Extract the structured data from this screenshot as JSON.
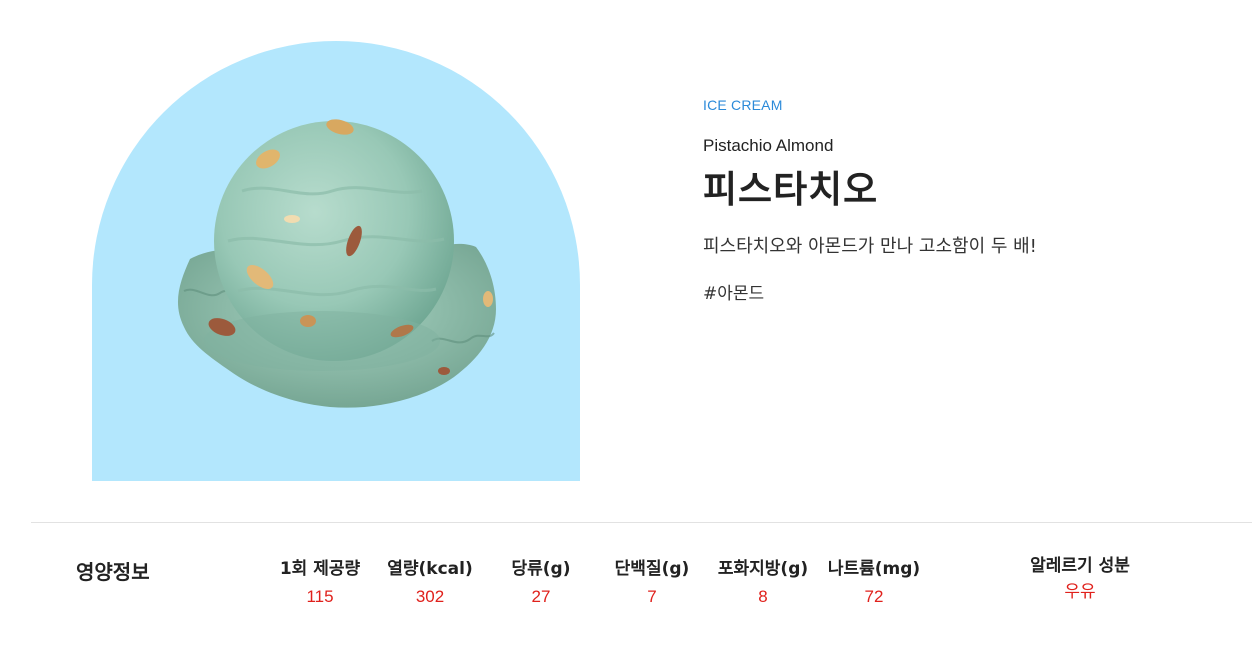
{
  "product": {
    "category": "ICE CREAM",
    "name_en": "Pistachio Almond",
    "name_ko": "피스타치오",
    "description": "피스타치오와 아몬드가 만나 고소함이 두 배!",
    "hashtag": "#아몬드",
    "image_bg_color": "#b3e7fd",
    "image_icon": "ice-cream-scoop"
  },
  "nutrition": {
    "title": "영양정보",
    "columns": [
      {
        "label": "1회 제공량",
        "value": "115"
      },
      {
        "label": "열량(kcal)",
        "value": "302"
      },
      {
        "label": "당류(g)",
        "value": "27"
      },
      {
        "label": "단백질(g)",
        "value": "7"
      },
      {
        "label": "포화지방(g)",
        "value": "8"
      },
      {
        "label": "나트륨(mg)",
        "value": "72"
      }
    ],
    "allergy": {
      "label": "알레르기 성분",
      "value": "우유"
    },
    "value_color": "#e0211c"
  }
}
